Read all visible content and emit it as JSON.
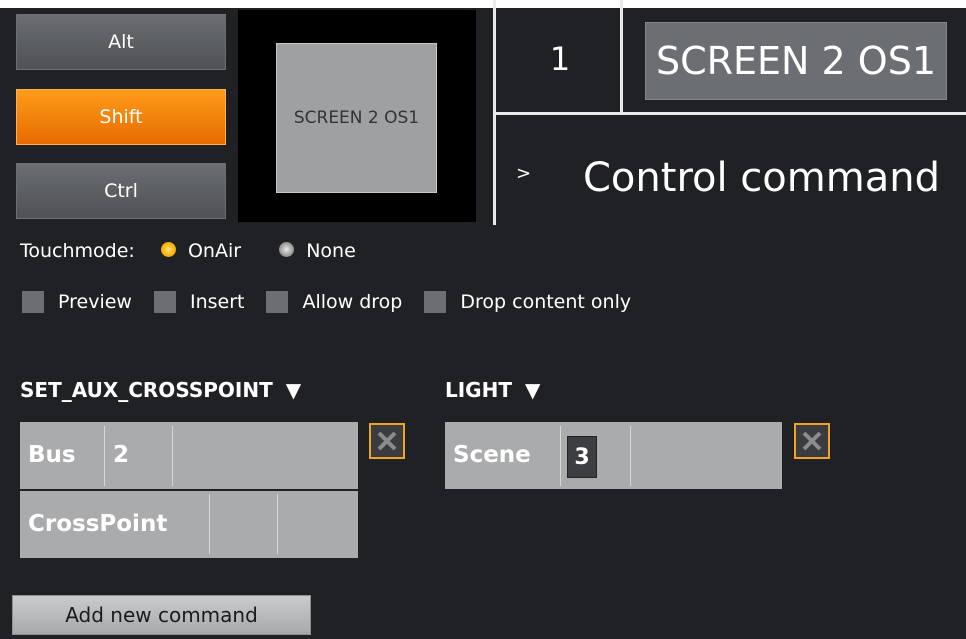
{
  "keys": {
    "alt": "Alt",
    "shift": "Shift",
    "ctrl": "Ctrl"
  },
  "preview": {
    "tile_label": "SCREEN 2 OS1"
  },
  "header": {
    "number": "1",
    "screen_button": "SCREEN 2 OS1",
    "chevron": ">",
    "title": "Control command"
  },
  "touchmode": {
    "label": "Touchmode:",
    "options": [
      "OnAir",
      "None"
    ],
    "selected": "OnAir"
  },
  "checkboxes": [
    "Preview",
    "Insert",
    "Allow drop",
    "Drop content only"
  ],
  "commands": [
    {
      "name": "SET_AUX_CROSSPOINT",
      "arrow": "▼",
      "rows": [
        {
          "label": "Bus",
          "value": "2"
        },
        {
          "label": "CrossPoint",
          "value": ""
        }
      ]
    },
    {
      "name": "LIGHT",
      "arrow": "▼",
      "rows": [
        {
          "label": "Scene",
          "value": "3"
        }
      ]
    }
  ],
  "add_button": "Add new command",
  "colors": {
    "accent": "#f0a320",
    "background": "#1f2124",
    "table": "#a9abad"
  }
}
